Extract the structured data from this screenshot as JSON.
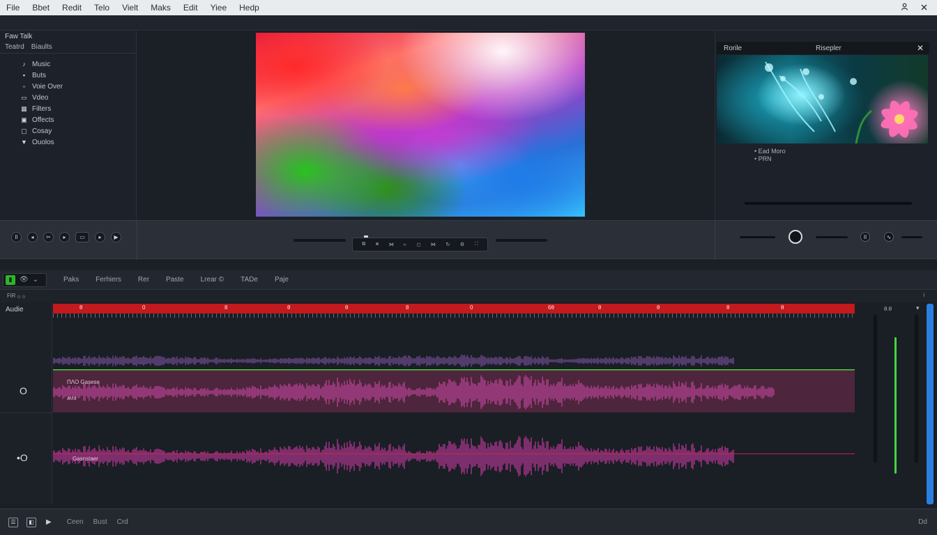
{
  "menubar": {
    "items": [
      "File",
      "Bbet",
      "Redit",
      "Telo",
      "Vielt",
      "Maks",
      "Edit",
      "Yiee",
      "Hedp"
    ],
    "right_icons": [
      "user-icon",
      "close-icon"
    ]
  },
  "left_panel": {
    "title": "Faw Talk",
    "tabs": [
      "Teatrd",
      "Biaults"
    ],
    "items": [
      {
        "icon": "music-icon",
        "label": "Music"
      },
      {
        "icon": "box-icon",
        "label": "Buts"
      },
      {
        "icon": "mic-icon",
        "label": "Voie Over"
      },
      {
        "icon": "video-icon",
        "label": "Vdeo"
      },
      {
        "icon": "filter-icon",
        "label": "Filters"
      },
      {
        "icon": "effects-icon",
        "label": "Offects"
      },
      {
        "icon": "copy-icon",
        "label": "Cosay"
      },
      {
        "icon": "funnel-icon",
        "label": "Ouolos"
      }
    ]
  },
  "right_panel": {
    "header_left": "Rorile",
    "header_right": "Risepler",
    "info_lines": [
      "• Ead Moro",
      "• PRN"
    ]
  },
  "timeline": {
    "tabs": [
      "Paks",
      "Ferhiers",
      "Rer",
      "Paste",
      "Lrear ©",
      "TADe",
      "Paje"
    ],
    "sub_left": "FiR ۞ ۞",
    "sub_right": "i",
    "ruler_marks": [
      "θ",
      "0",
      "8",
      "θ",
      "θ",
      "8",
      "0",
      "6θ",
      "θ",
      "θ",
      "θ",
      "θ"
    ],
    "ruler_end": "θ.θ",
    "tracks": {
      "audio_label": "Audie",
      "track1_label": "O",
      "track2_label": "•O",
      "clip1_name": "ΠΛΟ Gasese",
      "clip1_sub": "aMd",
      "clip2_name": "Gasnstaer"
    }
  },
  "bottombar": {
    "labels": [
      "Ceen",
      "Bust",
      "Crd"
    ],
    "right": "Dd"
  },
  "colors": {
    "accent_red": "#c21a1d",
    "accent_green": "#3fd13a",
    "clip_purple": "#a23a8a",
    "scroll_blue": "#2a7fe0"
  }
}
